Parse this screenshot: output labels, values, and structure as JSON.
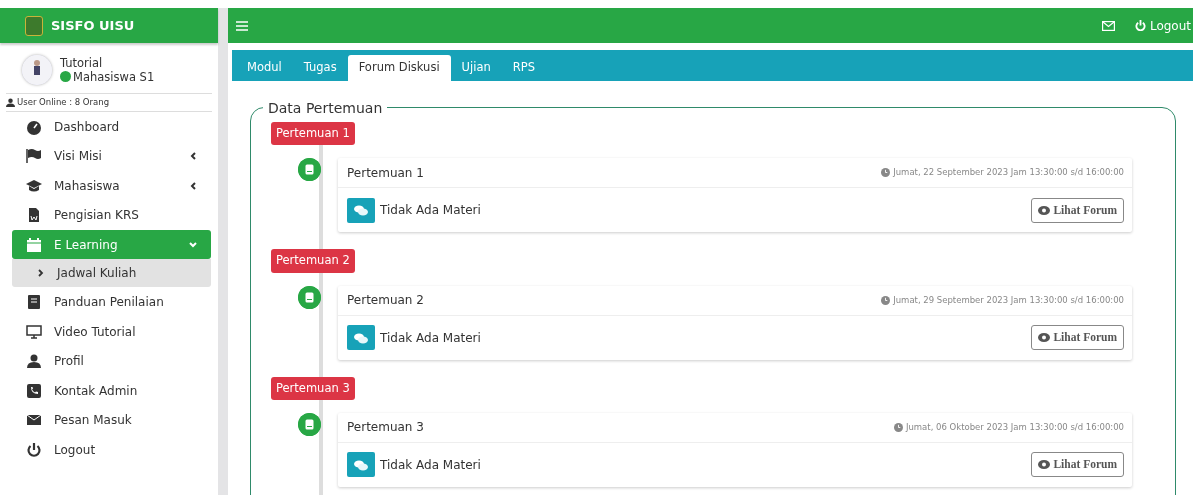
{
  "brand": {
    "title": "SISFO UISU"
  },
  "topbar": {
    "logout": "Logout"
  },
  "user": {
    "name": "Tutorial",
    "role": "Mahasiswa S1",
    "online": true,
    "online_count": "User Online : 8 Orang"
  },
  "sidebar": {
    "items": [
      {
        "label": "Dashboard",
        "selected": false
      },
      {
        "label": "Visi Misi",
        "selected": false,
        "expanded": false
      },
      {
        "label": "Mahasiswa",
        "selected": false,
        "expanded": false
      },
      {
        "label": "Pengisian KRS",
        "selected": false
      },
      {
        "label": "E Learning",
        "selected": true,
        "expanded": true,
        "children": [
          {
            "label": "Jadwal Kuliah",
            "selected": true
          }
        ]
      },
      {
        "label": "Panduan Penilaian",
        "selected": false
      },
      {
        "label": "Video Tutorial",
        "selected": false
      },
      {
        "label": "Profil",
        "selected": false
      },
      {
        "label": "Kontak Admin",
        "selected": false
      },
      {
        "label": "Pesan Masuk",
        "selected": false
      },
      {
        "label": "Logout",
        "selected": false
      }
    ]
  },
  "tabs": [
    {
      "label": "Modul",
      "selected": false
    },
    {
      "label": "Tugas",
      "selected": false
    },
    {
      "label": "Forum Diskusi",
      "selected": true
    },
    {
      "label": "Ujian",
      "selected": false
    },
    {
      "label": "RPS",
      "selected": false
    }
  ],
  "section": {
    "legend": "Data Pertemuan",
    "meetings": [
      {
        "badge": "Pertemuan 1",
        "title": "Pertemuan 1",
        "schedule": "Jumat, 22 September 2023 Jam 13:30:00 s/d 16:00:00",
        "material": "Tidak Ada Materi",
        "button": "Lihat Forum"
      },
      {
        "badge": "Pertemuan 2",
        "title": "Pertemuan 2",
        "schedule": "Jumat, 29 September 2023 Jam 13:30:00 s/d 16:00:00",
        "material": "Tidak Ada Materi",
        "button": "Lihat Forum"
      },
      {
        "badge": "Pertemuan 3",
        "title": "Pertemuan 3",
        "schedule": "Jumat, 06 Oktober 2023 Jam 13:30:00 s/d 16:00:00",
        "material": "Tidak Ada Materi",
        "button": "Lihat Forum"
      }
    ]
  }
}
